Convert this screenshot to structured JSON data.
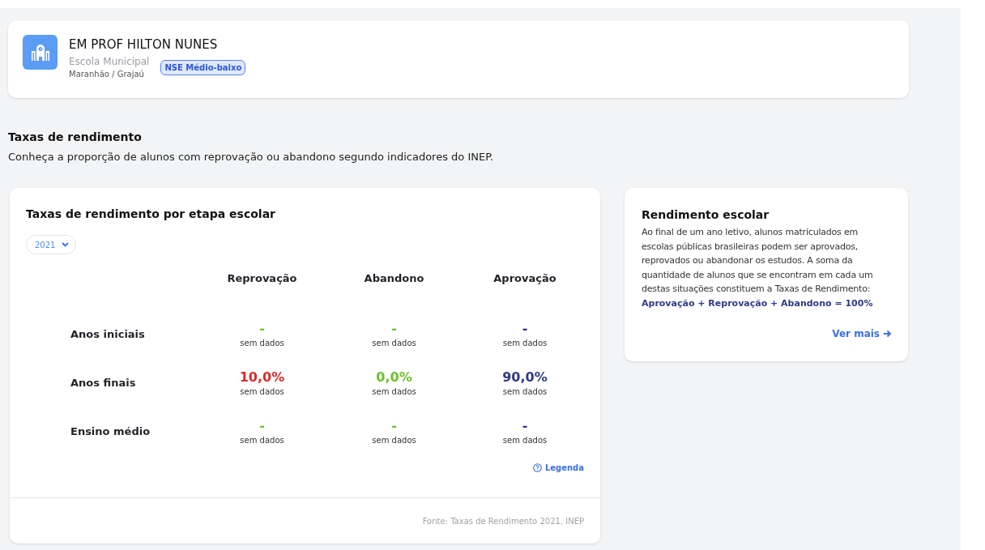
{
  "school": {
    "name": "EM PROF HILTON NUNES",
    "type": "Escola Municipal",
    "location": "Maranhão / Grajaú",
    "badge": "NSE Médio-baixo"
  },
  "section": {
    "title": "Taxas de rendimento",
    "subtitle": "Conheça a proporção de alunos com reprovação ou abandono segundo indicadores do INEP."
  },
  "rates_card": {
    "title": "Taxas de rendimento por etapa escolar",
    "year_select": "2021",
    "columns": [
      {
        "label": "Reprovação"
      },
      {
        "label": "Abandono"
      },
      {
        "label": "Aprovação"
      }
    ],
    "rows": [
      {
        "label": "Anos iniciais",
        "cells": [
          {
            "value": "-",
            "note": "sem dados",
            "color": "#6bbf2a"
          },
          {
            "value": "-",
            "note": "sem dados",
            "color": "#6bbf2a"
          },
          {
            "value": "-",
            "note": "sem dados",
            "color": "#2e3a87"
          }
        ]
      },
      {
        "label": "Anos finais",
        "cells": [
          {
            "value": "10,0%",
            "note": "sem dados",
            "color": "#e0282e"
          },
          {
            "value": "0,0%",
            "note": "sem dados",
            "color": "#6bbf2a"
          },
          {
            "value": "90,0%",
            "note": "sem dados",
            "color": "#2e3a87"
          }
        ]
      },
      {
        "label": "Ensino médio",
        "cells": [
          {
            "value": "-",
            "note": "sem dados",
            "color": "#6bbf2a"
          },
          {
            "value": "-",
            "note": "sem dados",
            "color": "#6bbf2a"
          },
          {
            "value": "-",
            "note": "sem dados",
            "color": "#2e3a87"
          }
        ]
      }
    ],
    "legend_link": "Legenda",
    "source": "Fonte: Taxas de Rendimento 2021, INEP"
  },
  "info_card": {
    "title": "Rendimento escolar",
    "text": "Ao final de um ano letivo, alunos matriculados em escolas públicas brasileiras podem ser aprovados, reprovados ou abandonar os estudos. A soma da quantidade de alunos que se encontram em cada um destas situações constituem a Taxas de Rendimento:",
    "formula": "Aprovação + Reprovação + Abandono = 100%",
    "link": "Ver mais"
  }
}
